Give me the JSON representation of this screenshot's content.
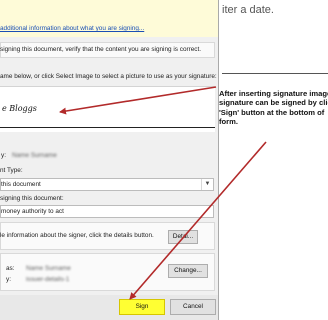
{
  "dialog": {
    "info_link": "additional information about what you are signing...",
    "verify_text": "signing this document, verify that the content you are signing is correct.",
    "instructions": "ame below, or click Select Image to select a picture to use as your signature:",
    "signature_name": "e Bloggs",
    "signed_by_label": "y:",
    "signed_by_value": "Name Surname",
    "commitment_type_label": "nt Type:",
    "commitment_type_value": "this document",
    "purpose_label": "signing this document:",
    "purpose_value": "money authority to act",
    "details_text": "le information about the signer, click the details button.",
    "details_button": "Detai...",
    "issued_to_label": "as:",
    "issued_to_value": "Name Surname",
    "issued_by_label": "y:",
    "issued_by_value": "issuer-details-1",
    "change_button": "Change...",
    "sign_button": "Sign",
    "cancel_button": "Cancel"
  },
  "document": {
    "top_text": "iter a date."
  },
  "annotation": {
    "text": "After inserting signature image\nsignature can be signed by click\n'Sign' button at the bottom of\nform."
  },
  "colors": {
    "highlight": "#ffff33",
    "arrow": "#b22a2a",
    "link": "#1a4fb5"
  }
}
